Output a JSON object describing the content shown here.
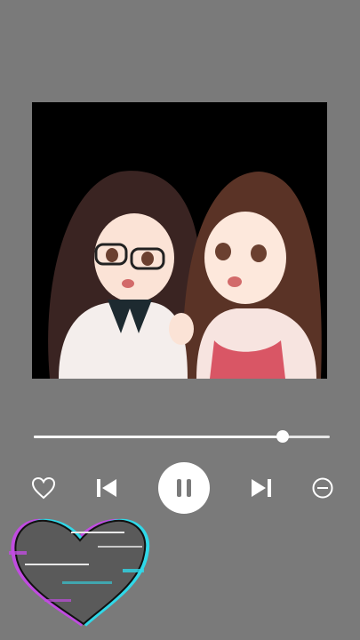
{
  "player": {
    "progress_fraction": 0.84,
    "is_playing": true
  },
  "controls": {
    "like": "heart-outline-icon",
    "previous": "skip-previous-icon",
    "play_pause": "pause-icon",
    "next": "skip-next-icon",
    "remove": "minus-circle-icon"
  },
  "colors": {
    "background": "#7a7a7a",
    "foreground": "#ffffff",
    "glitch_magenta": "#c04ce0",
    "glitch_cyan": "#30d8e8"
  },
  "decor": {
    "sticker": "glitch-heart"
  }
}
